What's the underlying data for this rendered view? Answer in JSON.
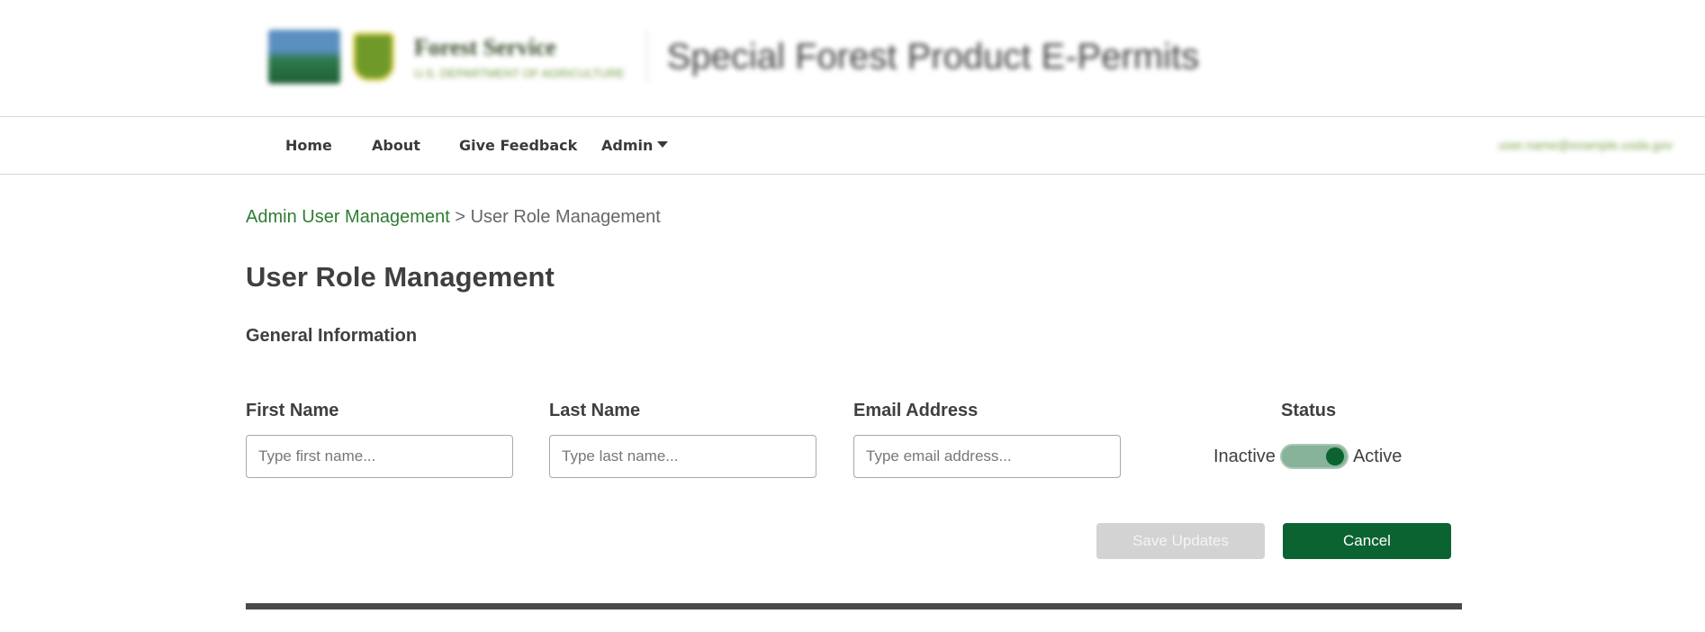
{
  "header": {
    "agency_name": "Forest Service",
    "agency_subtitle": "U.S. DEPARTMENT OF AGRICULTURE",
    "site_title": "Special Forest Product E-Permits"
  },
  "nav": {
    "items": [
      {
        "label": "Home"
      },
      {
        "label": "About"
      },
      {
        "label": "Give Feedback"
      },
      {
        "label": "Admin"
      }
    ],
    "user_link": "user.name@example.usda.gov"
  },
  "breadcrumb": {
    "parent": "Admin User Management",
    "separator": " > ",
    "current": "User Role Management"
  },
  "page": {
    "title": "User Role Management",
    "section_title": "General Information"
  },
  "form": {
    "first_name": {
      "label": "First Name",
      "placeholder": "Type first name...",
      "value": ""
    },
    "last_name": {
      "label": "Last Name",
      "placeholder": "Type last name...",
      "value": ""
    },
    "email": {
      "label": "Email Address",
      "placeholder": "Type email address...",
      "value": ""
    },
    "status": {
      "label": "Status",
      "off_label": "Inactive",
      "on_label": "Active",
      "active": true
    }
  },
  "actions": {
    "save_label": "Save Updates",
    "save_disabled": true,
    "cancel_label": "Cancel"
  },
  "colors": {
    "brand_green": "#0b6331",
    "link_green": "#2e7d32",
    "toggle_track": "#86b39a",
    "disabled_button": "#d3d3d3"
  }
}
